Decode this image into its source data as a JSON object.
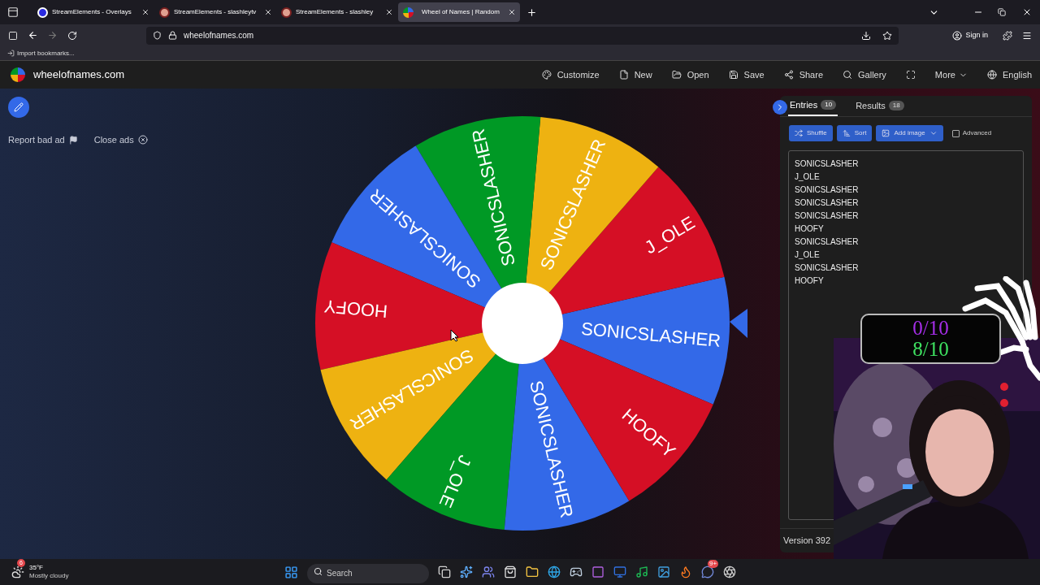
{
  "browser": {
    "tabs": [
      {
        "title": "StreamElements - Overlays",
        "selected": false,
        "kind": "se"
      },
      {
        "title": "StreamElements - slashleytv",
        "selected": false,
        "kind": "bowl"
      },
      {
        "title": "StreamElements - slashley",
        "selected": false,
        "kind": "bowl"
      },
      {
        "title": "Wheel of Names | Random",
        "selected": true,
        "kind": "wheel"
      }
    ],
    "url": "wheelofnames.com",
    "sign_in": "Sign in",
    "bookmark": "Import bookmarks..."
  },
  "site": {
    "logo": "wheelofnames.com",
    "menu": [
      "Customize",
      "New",
      "Open",
      "Save",
      "Share",
      "Gallery",
      "More",
      "English"
    ]
  },
  "ads": {
    "report": "Report bad ad",
    "close": "Close ads"
  },
  "wheel": {
    "slices": [
      {
        "label": "SONICSLASHER",
        "color": "#3369e8"
      },
      {
        "label": "J_OLE",
        "color": "#d50f25"
      },
      {
        "label": "SONICSLASHER",
        "color": "#eeb211"
      },
      {
        "label": "SONICSLASHER",
        "color": "#009925"
      },
      {
        "label": "SONICSLASHER",
        "color": "#3369e8"
      },
      {
        "label": "HOOFY",
        "color": "#d50f25"
      },
      {
        "label": "SONICSLASHER",
        "color": "#eeb211"
      },
      {
        "label": "J_OLE",
        "color": "#009925"
      },
      {
        "label": "SONICSLASHER",
        "color": "#3369e8"
      },
      {
        "label": "HOOFY",
        "color": "#d50f25"
      }
    ]
  },
  "panel": {
    "tabs": [
      {
        "label": "Entries",
        "count": "10",
        "selected": true
      },
      {
        "label": "Results",
        "count": "18",
        "selected": false
      }
    ],
    "buttons": [
      "Shuffle",
      "Sort",
      "Add image"
    ],
    "advanced": {
      "label": "Advanced",
      "checked": false
    },
    "entries": [
      "SONICSLASHER",
      "J_OLE",
      "SONICSLASHER",
      "SONICSLASHER",
      "SONICSLASHER",
      "HOOFY",
      "SONICSLASHER",
      "J_OLE",
      "SONICSLASHER",
      "HOOFY"
    ],
    "version": "Version 392"
  },
  "overlay": {
    "counters": [
      {
        "text": "0/10",
        "color": "#a52ee8"
      },
      {
        "text": "8/10",
        "color": "#3ee060"
      }
    ]
  },
  "taskbar": {
    "weather": {
      "badge": "6",
      "temp": "35°F",
      "condition": "Mostly cloudy"
    },
    "search": {
      "placeholder": "Search"
    },
    "chat_badge": "9+"
  }
}
